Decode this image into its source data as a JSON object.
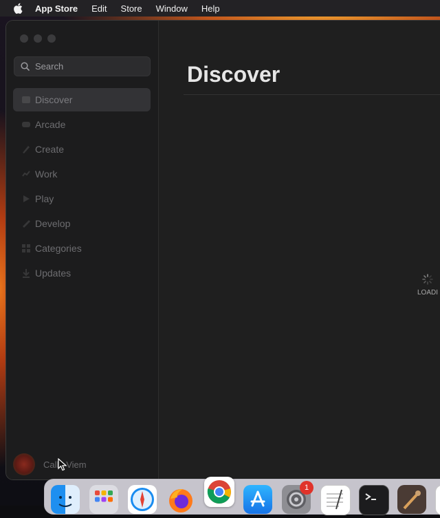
{
  "menubar": {
    "app_name": "App Store",
    "items": [
      "Edit",
      "Store",
      "Window",
      "Help"
    ]
  },
  "sidebar": {
    "search_placeholder": "Search",
    "items": [
      {
        "label": "Discover",
        "active": true
      },
      {
        "label": "Arcade",
        "active": false
      },
      {
        "label": "Create",
        "active": false
      },
      {
        "label": "Work",
        "active": false
      },
      {
        "label": "Play",
        "active": false
      },
      {
        "label": "Develop",
        "active": false
      },
      {
        "label": "Categories",
        "active": false
      },
      {
        "label": "Updates",
        "active": false
      }
    ],
    "account_name": "Callo Viem"
  },
  "main": {
    "title": "Discover",
    "loading_text": "LOADI"
  },
  "dock": {
    "apps": [
      "finder-icon",
      "launchpad-icon",
      "safari-icon",
      "firefox-icon",
      "chrome-icon",
      "app-store-icon",
      "system-settings-icon",
      "textedit-icon",
      "terminal-icon",
      "instruments-icon"
    ],
    "settings_badge": "1"
  },
  "colors": {
    "window_bg": "#1f1f1f",
    "sidebar_bg": "#1c1c1d",
    "active_item_bg": "#333336",
    "badge": "#e0332a"
  }
}
